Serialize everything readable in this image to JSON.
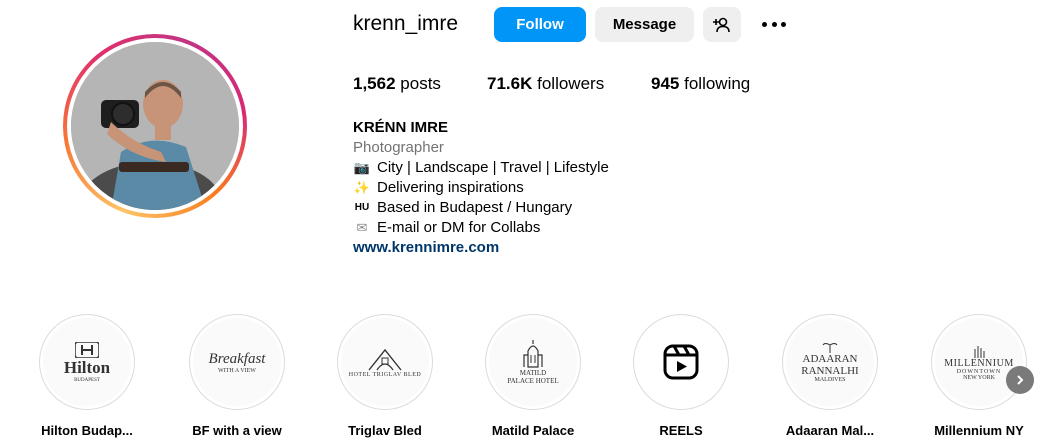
{
  "profile": {
    "username": "krenn_imre",
    "follow_label": "Follow",
    "message_label": "Message",
    "add_user_icon": "person-add-icon",
    "more_icon": "more-dots-icon"
  },
  "stats": {
    "posts_count": "1,562",
    "posts_label": "posts",
    "followers_count": "71.6K",
    "followers_label": "followers",
    "following_count": "945",
    "following_label": "following"
  },
  "bio": {
    "name": "KRÉNN IMRE",
    "category": "Photographer",
    "lines": [
      {
        "icon": "camera-emoji",
        "glyph": "📷",
        "text": "City | Landscape | Travel | Lifestyle"
      },
      {
        "icon": "sparkles-emoji",
        "glyph": "✨",
        "text": "Delivering inspirations"
      },
      {
        "icon": "flag-hu-emoji",
        "glyph": "HU",
        "text": "Based in Budapest / Hungary"
      },
      {
        "icon": "envelope-emoji",
        "glyph": "✉",
        "text": "E-mail or DM for Collabs"
      }
    ],
    "link": "www.krennimre.com"
  },
  "highlights": [
    {
      "label": "Hilton Budap...",
      "logo": "Hilton",
      "sub": "BUDAPEST"
    },
    {
      "label": "BF with a view",
      "logo": "Breakfast",
      "sub": "WITH A VIEW"
    },
    {
      "label": "Triglav Bled",
      "logo": "HOTEL TRIGLAV BLED",
      "sub": ""
    },
    {
      "label": "Matild Palace",
      "logo": "MATILD",
      "sub": "PALACE HOTEL"
    },
    {
      "label": "REELS",
      "logo": "",
      "sub": ""
    },
    {
      "label": "Adaaran Mal...",
      "logo": "ADAARAN",
      "sub": "RANNALHI",
      "sub2": "MALDIVES"
    },
    {
      "label": "Millennium NY",
      "logo": "MILLENNIUM",
      "sub": "DOWNTOWN",
      "sub2": "NEW YORK"
    }
  ],
  "colors": {
    "follow_blue": "#0095f6",
    "link_blue": "#00376b",
    "secondary_gray": "#efefef",
    "muted_text": "#737373"
  }
}
